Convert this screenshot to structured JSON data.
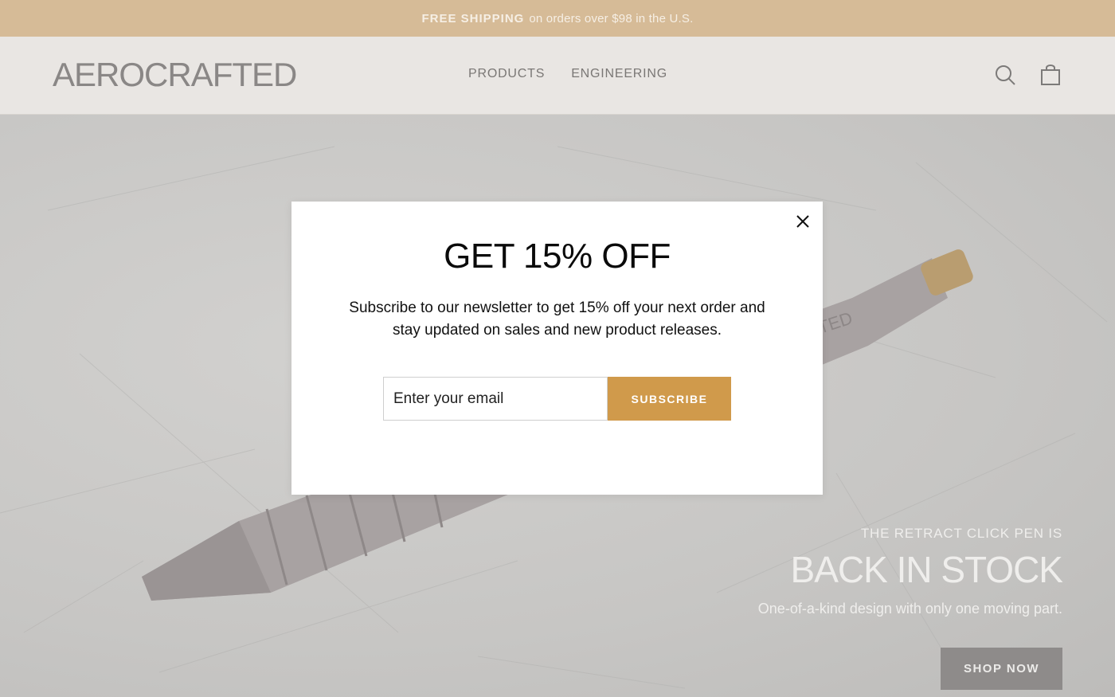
{
  "announcement": {
    "bold": "FREE SHIPPING",
    "text": "on orders over $98 in the U.S."
  },
  "header": {
    "logo": "AEROCRAFTED",
    "nav": [
      {
        "label": "PRODUCTS"
      },
      {
        "label": "ENGINEERING"
      }
    ],
    "icons": [
      "search-icon",
      "cart-icon"
    ]
  },
  "hero": {
    "eyebrow": "THE RETRACT CLICK PEN IS",
    "title": "BACK IN STOCK",
    "subtitle": "One-of-a-kind design with only one moving part.",
    "cta": "SHOP NOW",
    "pen_engraving": "TED"
  },
  "modal": {
    "title": "GET 15% OFF",
    "description": "Subscribe to our newsletter to get 15% off your next order and stay updated on sales and new product releases.",
    "email_placeholder": "Enter your email",
    "subscribe_label": "SUBSCRIBE",
    "close_icon": "close-icon"
  },
  "colors": {
    "announcement_bg": "#d6bb97",
    "header_bg": "#e9e6e3",
    "accent": "#d09a4b",
    "shop_button": "#8e8b8a"
  }
}
